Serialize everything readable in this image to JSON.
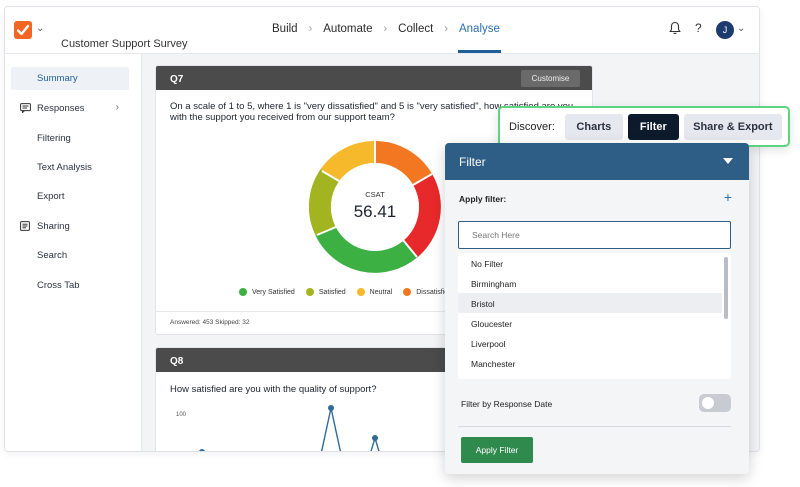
{
  "app": {
    "survey_title": "Customer Support Survey"
  },
  "nav": {
    "build": "Build",
    "automate": "Automate",
    "collect": "Collect",
    "analyse": "Analyse",
    "help": "?",
    "avatar_initial": "J"
  },
  "sidebar": {
    "items": [
      {
        "label": "Summary"
      },
      {
        "label": "Responses"
      },
      {
        "label": "Filtering"
      },
      {
        "label": "Text Analysis"
      },
      {
        "label": "Export"
      },
      {
        "label": "Sharing"
      },
      {
        "label": "Search"
      },
      {
        "label": "Cross Tab"
      }
    ]
  },
  "q7": {
    "id": "Q7",
    "customise": "Customise",
    "question_line1": "On a scale of 1 to 5, where 1 is \"very dissatisfied\" and 5 is \"very satisfied\", how satisfied are you",
    "question_line2": "with the support you received from our support team?",
    "metric_label": "CSAT",
    "metric_value": "56.41",
    "legend": [
      "Very Satisfied",
      "Satisfied",
      "Neutral",
      "Dissatisfied"
    ],
    "footer": "Answered: 453 Skipped: 32",
    "colors": {
      "very_satisfied": "#3cb043",
      "satisfied": "#a2b41f",
      "neutral": "#f6b92b",
      "dissatisfied": "#f37621",
      "very_dissatisfied": "#e8292b"
    }
  },
  "q8": {
    "id": "Q8",
    "question": "How satisfied are you with the quality of support?",
    "y_tick": "100"
  },
  "discover": {
    "label": "Discover:",
    "charts": "Charts",
    "filter": "Filter",
    "share": "Share & Export"
  },
  "filter_panel": {
    "title": "Filter",
    "apply_filter_label": "Apply filter:",
    "search_placeholder": "Search Here",
    "options": [
      "No Filter",
      "Birmingham",
      "Bristol",
      "Gloucester",
      "Liverpool",
      "Manchester"
    ],
    "date_label": "Filter by Response Date",
    "apply_button": "Apply Filter"
  }
}
